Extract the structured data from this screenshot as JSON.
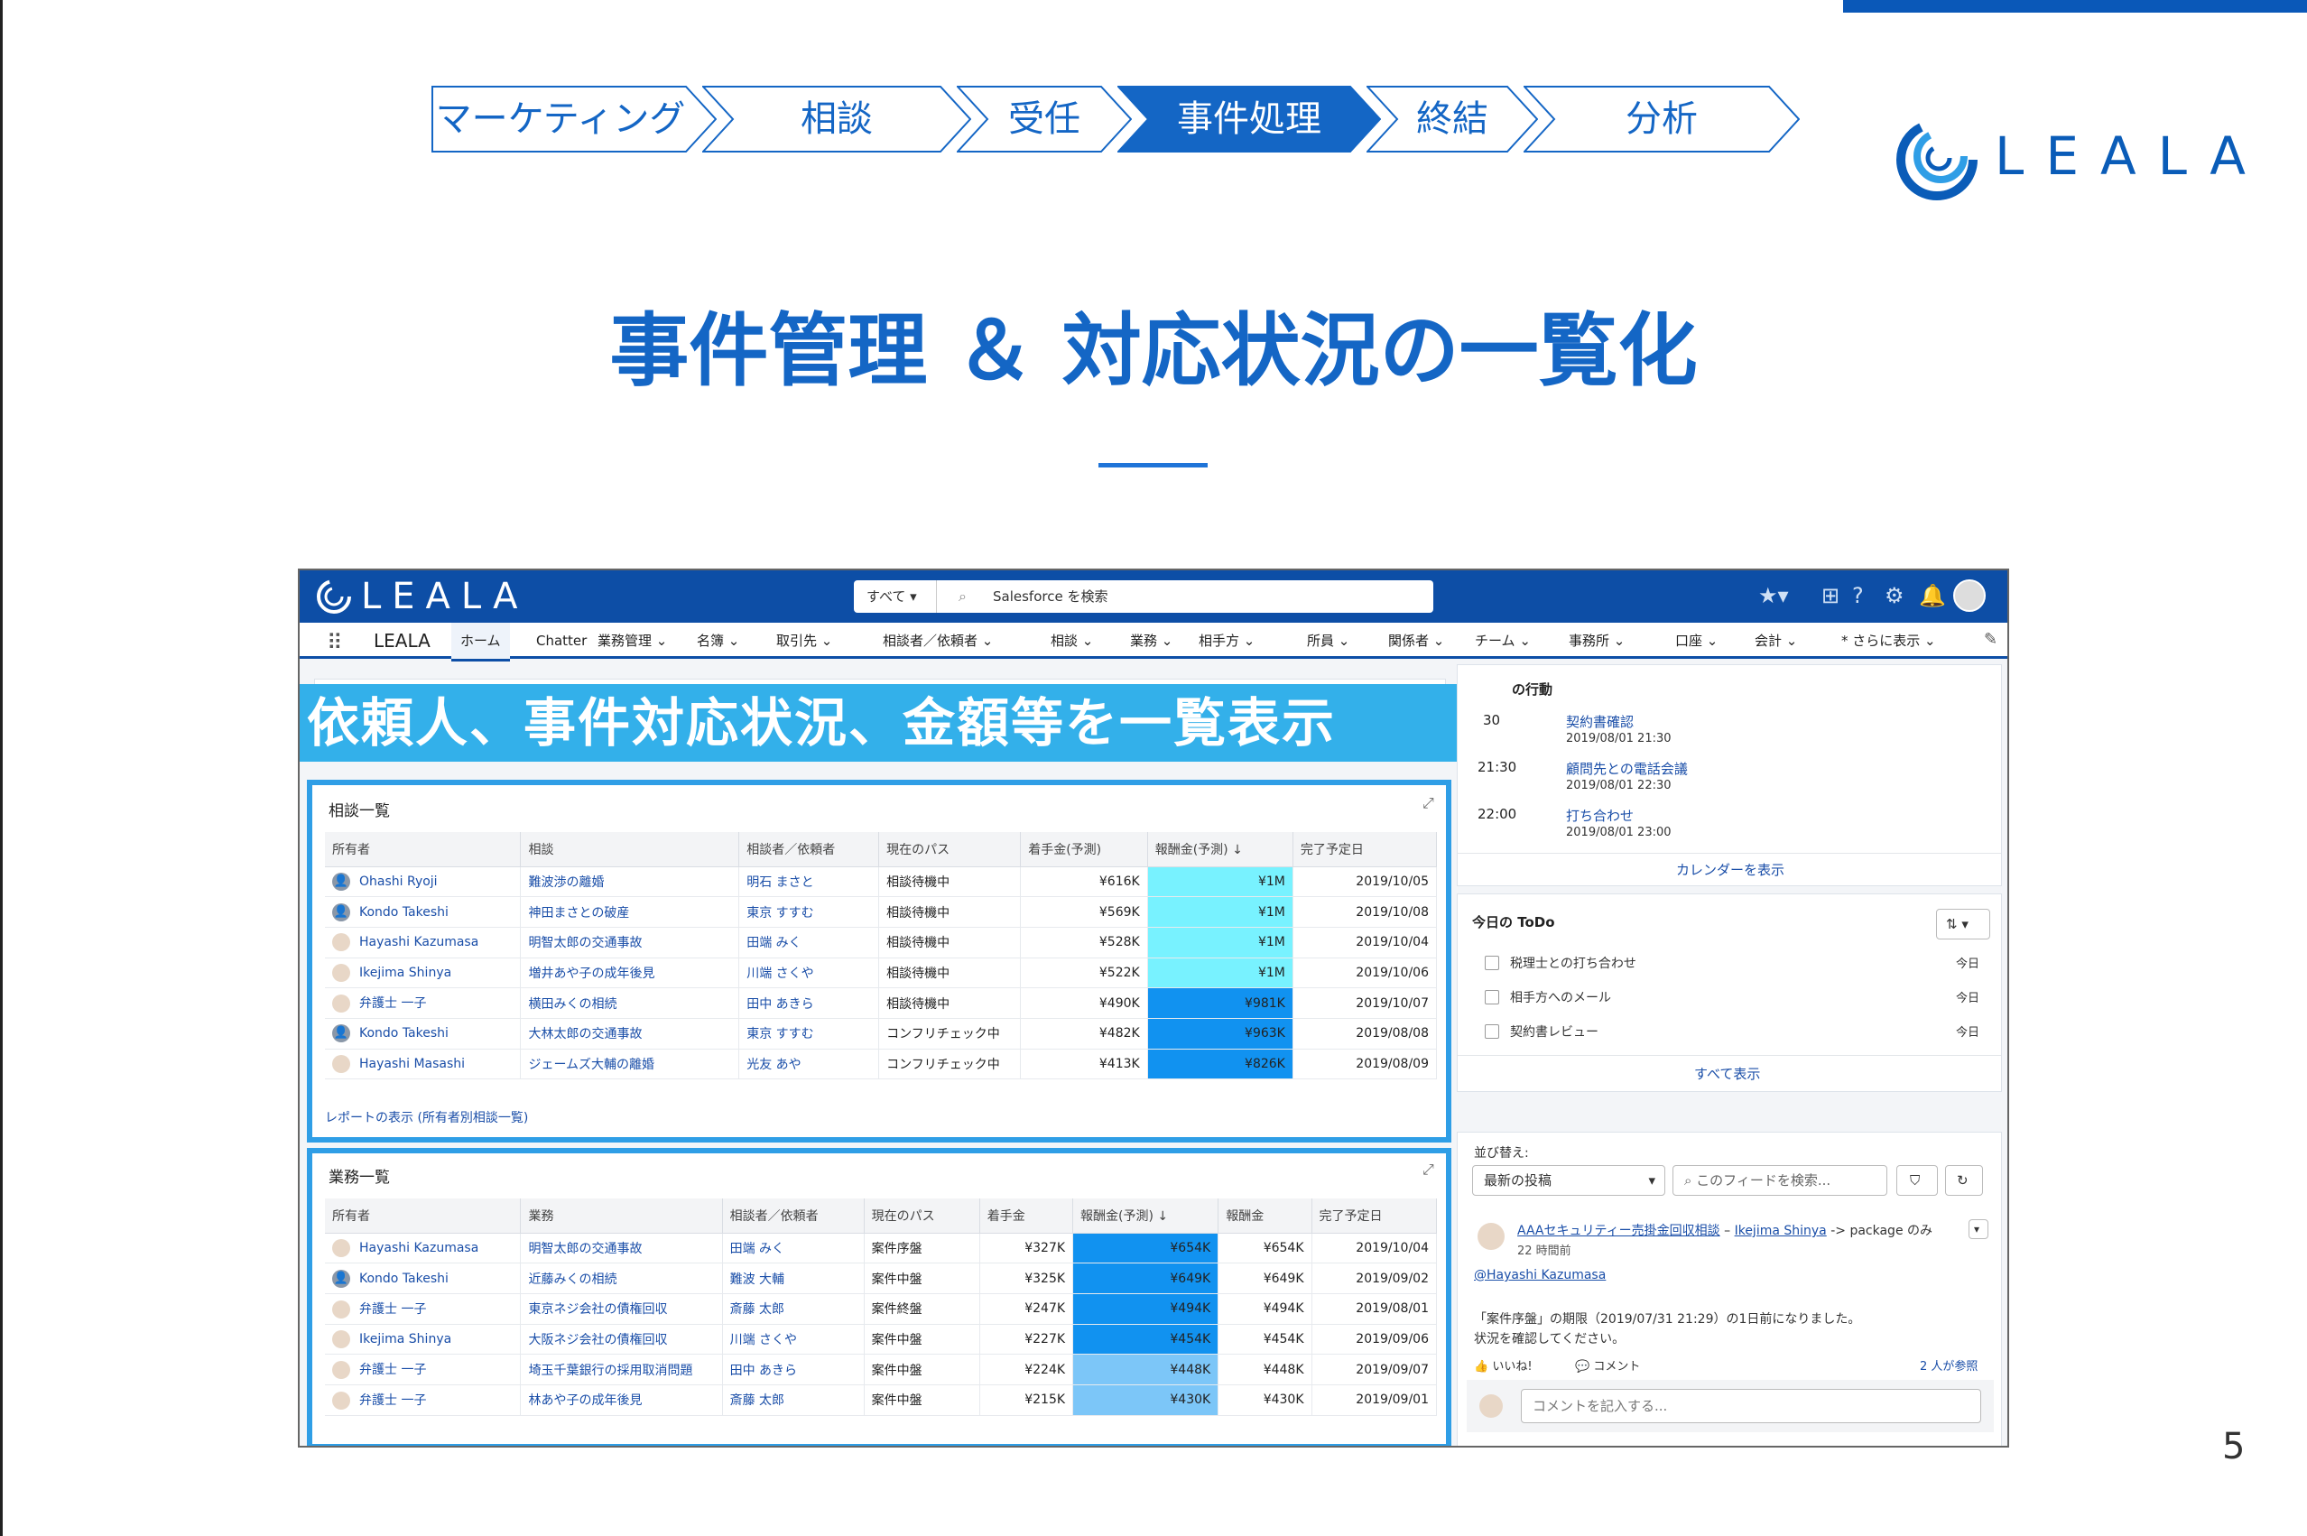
{
  "process_steps": [
    "マーケティング",
    "相談",
    "受任",
    "事件処理",
    "終結",
    "分析"
  ],
  "active_step_index": 3,
  "logo_text": "LEALA",
  "title": "事件管理 ＆ 対応状況の一覧化",
  "page_number": "5",
  "banner": "依頼人、事件対応状況、金額等を一覧表示",
  "app": {
    "logo_text": "LEALA",
    "search_scope": "すべて",
    "search_placeholder": "Salesforce を検索",
    "app_name": "LEALA",
    "nav": [
      "ホーム",
      "Chatter",
      "業務管理",
      "名簿",
      "取引先",
      "相談者／依頼者",
      "相談",
      "業務",
      "相手方",
      "所員",
      "関係者",
      "チーム",
      "事務所",
      "口座",
      "会計",
      "* さらに表示"
    ]
  },
  "consult_table": {
    "title": "相談一覧",
    "columns": [
      "所有者",
      "相談",
      "相談者／依頼者",
      "現在のパス",
      "着手金(予測)",
      "報酬金(予測) ↓",
      "完了予定日"
    ],
    "rows": [
      [
        "Ohashi Ryoji",
        "難波渉の離婚",
        "明石 まさと",
        "相談待機中",
        "¥616K",
        "¥1M",
        "2019/10/05"
      ],
      [
        "Kondo Takeshi",
        "神田まさとの破産",
        "東京 すすむ",
        "相談待機中",
        "¥569K",
        "¥1M",
        "2019/10/08"
      ],
      [
        "Hayashi Kazumasa",
        "明智太郎の交通事故",
        "田端 みく",
        "相談待機中",
        "¥528K",
        "¥1M",
        "2019/10/04"
      ],
      [
        "Ikejima Shinya",
        "増井あや子の成年後見",
        "川端 さくや",
        "相談待機中",
        "¥522K",
        "¥1M",
        "2019/10/06"
      ],
      [
        "弁護士 一子",
        "横田みくの相続",
        "田中 あきら",
        "相談待機中",
        "¥490K",
        "¥981K",
        "2019/10/07"
      ],
      [
        "Kondo Takeshi",
        "大林太郎の交通事故",
        "東京 すすむ",
        "コンフリチェック中",
        "¥482K",
        "¥963K",
        "2019/08/08"
      ],
      [
        "Hayashi Masashi",
        "ジェームズ大輔の離婚",
        "光友 あや",
        "コンフリチェック中",
        "¥413K",
        "¥826K",
        "2019/08/09"
      ]
    ],
    "report_link": "レポートの表示 (所有者別相談一覧)"
  },
  "work_table": {
    "title": "業務一覧",
    "columns": [
      "所有者",
      "業務",
      "相談者／依頼者",
      "現在のパス",
      "着手金",
      "報酬金(予測) ↓",
      "報酬金",
      "完了予定日"
    ],
    "rows": [
      [
        "Hayashi Kazumasa",
        "明智太郎の交通事故",
        "田端 みく",
        "案件序盤",
        "¥327K",
        "¥654K",
        "¥654K",
        "2019/10/04"
      ],
      [
        "Kondo Takeshi",
        "近藤みくの相続",
        "難波 大輔",
        "案件中盤",
        "¥325K",
        "¥649K",
        "¥649K",
        "2019/09/02"
      ],
      [
        "弁護士 一子",
        "東京ネジ会社の債権回収",
        "斎藤 太郎",
        "案件終盤",
        "¥247K",
        "¥494K",
        "¥494K",
        "2019/08/01"
      ],
      [
        "Ikejima Shinya",
        "大阪ネジ会社の債権回収",
        "川端 さくや",
        "案件中盤",
        "¥227K",
        "¥454K",
        "¥454K",
        "2019/09/06"
      ],
      [
        "弁護士 一子",
        "埼玉千葉銀行の採用取消問題",
        "田中 あきら",
        "案件中盤",
        "¥224K",
        "¥448K",
        "¥448K",
        "2019/09/07"
      ],
      [
        "弁護士 一子",
        "林あや子の成年後見",
        "斎藤 太郎",
        "案件中盤",
        "¥215K",
        "¥430K",
        "¥430K",
        "2019/09/01"
      ]
    ]
  },
  "events": {
    "title_suffix": "の行動",
    "items": [
      {
        "time": "30",
        "title": "契約書確認",
        "when": "2019/08/01 21:30"
      },
      {
        "time": "21:30",
        "title": "顧問先との電話会議",
        "when": "2019/08/01 22:30"
      },
      {
        "time": "22:00",
        "title": "打ち合わせ",
        "when": "2019/08/01 23:00"
      }
    ],
    "calendar_link": "カレンダーを表示"
  },
  "todo": {
    "title": "今日の ToDo",
    "items": [
      {
        "label": "税理士との打ち合わせ",
        "due": "今日"
      },
      {
        "label": "相手方へのメール",
        "due": "今日"
      },
      {
        "label": "契約書レビュー",
        "due": "今日"
      }
    ],
    "show_all": "すべて表示"
  },
  "feed": {
    "sort_label": "並び替え:",
    "sort_value": "最新の投稿",
    "search_placeholder": "このフィードを検索...",
    "post_link": "AAAセキュリティー売掛金回収相談",
    "post_sep": " – ",
    "post_user": "Ikejima Shinya",
    "post_rest": " -> package のみ",
    "post_time": "22 時間前",
    "mention": "@Hayashi Kazumasa",
    "body_line1": "「案件序盤」の期限（2019/07/31 21:29）の1日前になりました。",
    "body_line2": "状況を確認してください。",
    "like": "いいね!",
    "comment": "コメント",
    "views": "2 人が参照",
    "comment_placeholder": "コメントを記入する..."
  },
  "colors": {
    "brand": "#1466c5",
    "header": "#0d4ea6",
    "banner": "#33b0ea",
    "cell_1m": "#78f2ff",
    "cell_mid": "#7cc6f8",
    "cell_high": "#1192f0"
  }
}
